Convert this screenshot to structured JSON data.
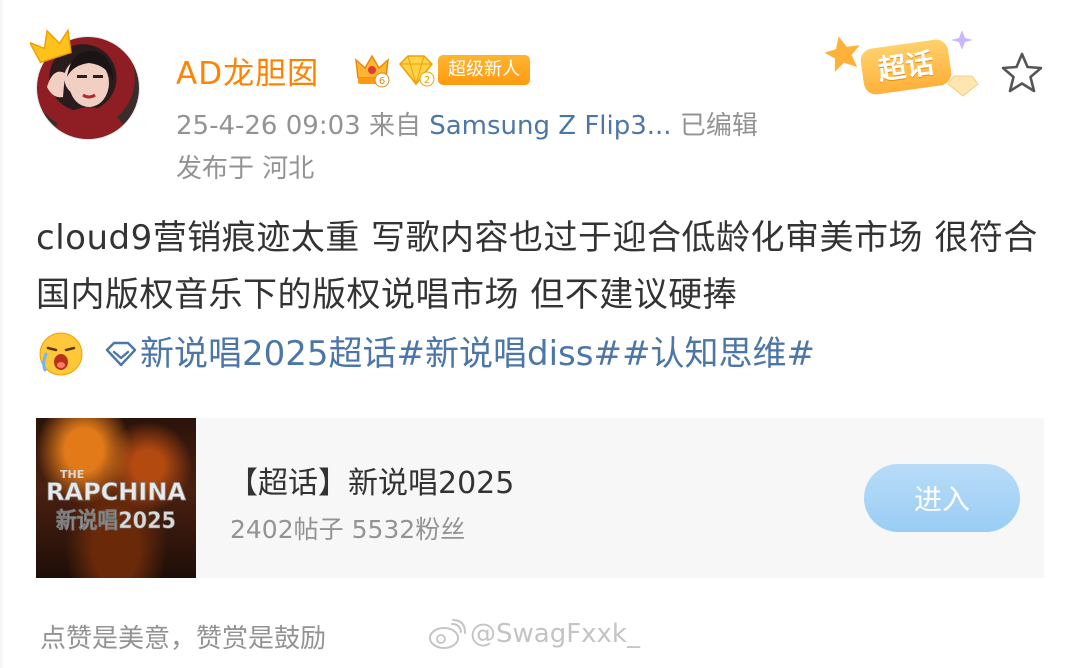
{
  "post": {
    "username": "AD龙胆囡",
    "newbie_badge": "超级新人",
    "level_number": "6",
    "diamond_number": "2",
    "timestamp": "25-4-26 09:03",
    "from_label": "来自",
    "source_device": "Samsung Z Flip3...",
    "edited_label": "已编辑",
    "location": "发布于 河北",
    "supertopic_sticker": "超话",
    "text": "cloud9营销痕迹太重 写歌内容也过于迎合低龄化审美市场 很符合国内版权音乐下的版权说唱市场 但不建议硬捧",
    "hashtags": [
      "新说唱2025超话",
      "#新说唱diss#",
      "#认知思维#"
    ]
  },
  "card": {
    "title": "【超话】新说唱2025",
    "stats": "2402帖子 5532粉丝",
    "button_label": "进入",
    "image_text_top": "THE",
    "image_text_main": "RAPCHINA",
    "image_text_sub": "新说唱2025"
  },
  "footer": {
    "text": "点赞是美意，赞赏是鼓励",
    "watermark": "@SwagFxxk_"
  },
  "colors": {
    "username": "#ff8200",
    "link": "#4d76a8",
    "meta": "#939393",
    "button": "#9acdf4"
  },
  "icons": [
    "crown-icon",
    "level-crown-icon",
    "diamond-icon",
    "supertopic-sticker-icon",
    "star-icon",
    "cry-emoji-icon",
    "supertopic-diamond-icon",
    "weibo-watermark-icon"
  ]
}
